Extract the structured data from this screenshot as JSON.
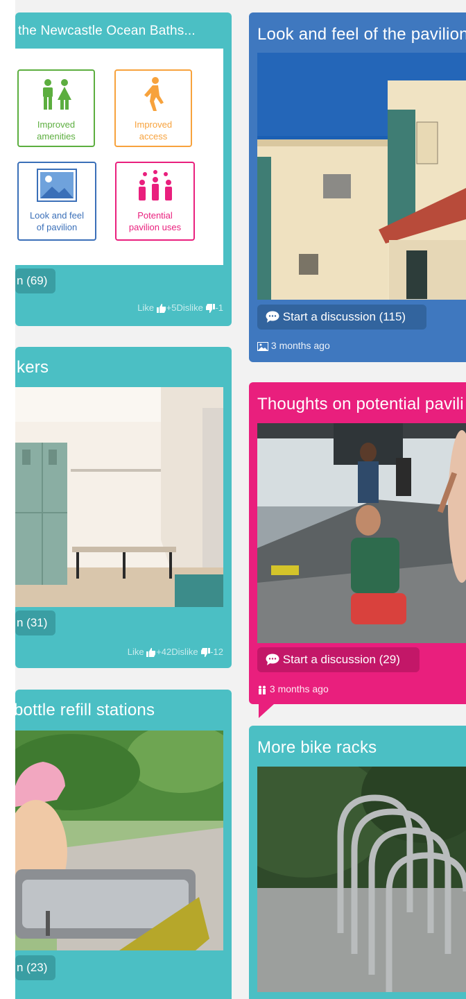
{
  "colors": {
    "teal": "#4bbfc4",
    "blue": "#3f78bf",
    "pink": "#e91f7d",
    "grey_bg": "#f2f2f2"
  },
  "cards_left": [
    {
      "title": "the Newcastle Ocean Baths...",
      "discussion_label": "n (69)",
      "likes_text": "Like",
      "likes_value": "+5",
      "dislike_text": "Dislike",
      "dislike_value": "-1",
      "tiles": [
        {
          "label_line1": "Improved",
          "label_line2": "amenities",
          "color": "#5cae3f",
          "icon": "toilets-icon"
        },
        {
          "label_line1": "Improved",
          "label_line2": "access",
          "color": "#f7a23c",
          "icon": "walking-person-icon"
        },
        {
          "label_line1": "Look and feel",
          "label_line2": "of pavilion",
          "color": "#3a6fb8",
          "icon": "landscape-image-icon"
        },
        {
          "label_line1": "Potential",
          "label_line2": "pavilion uses",
          "color": "#e91f7d",
          "icon": "group-people-icon"
        }
      ]
    },
    {
      "title": "kers",
      "discussion_label": "n (31)",
      "likes_text": "Like",
      "likes_value": "+42",
      "dislike_text": "Dislike",
      "dislike_value": "-12"
    },
    {
      "title": "bottle refill stations",
      "discussion_label": "n (23)"
    }
  ],
  "cards_right": [
    {
      "title": "Look and feel of the pavilion",
      "button_label": "Start a discussion (115)",
      "time": "3 months ago",
      "category_icon": "image-icon"
    },
    {
      "title": "Thoughts on potential pavili",
      "button_label": "Start a discussion (29)",
      "time": "3 months ago",
      "category_icon": "people-icon"
    },
    {
      "title": "More bike racks"
    }
  ]
}
